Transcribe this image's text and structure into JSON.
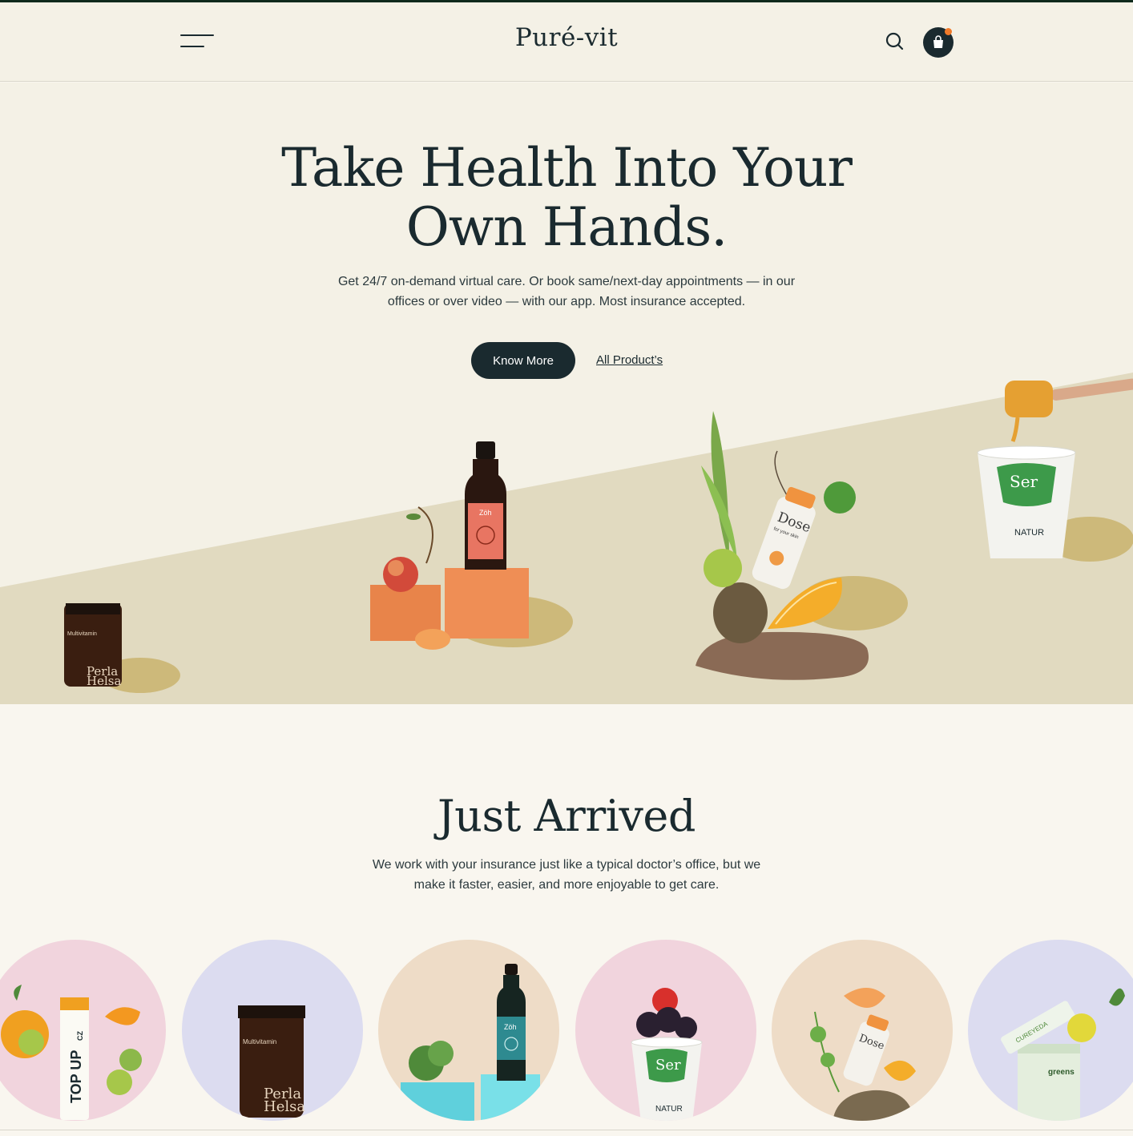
{
  "header": {
    "logo": "Puré-vit",
    "menu_icon": "hamburger-menu-icon",
    "search_icon": "search-icon",
    "cart_icon": "shopping-bag-icon"
  },
  "hero": {
    "title_line1": "Take Health Into Your",
    "title_line2": "Own Hands.",
    "description": "Get 24/7 on-demand virtual care. Or book same/next-day appointments — in our offices or over video — with our app. Most insurance accepted.",
    "primary_button": "Know More",
    "secondary_link": "All Product’s",
    "products": {
      "jar_label_1": "Perla",
      "jar_label_2": "Helsa",
      "jar_small": "Multivitamin",
      "bottle_label": "Zöh",
      "dose_label": "Dose",
      "dose_sub": "for your skin",
      "cup_label": "Ser",
      "cup_sub": "NATUR"
    }
  },
  "arrived": {
    "title": "Just Arrived",
    "description": "We work with your insurance just like a typical doctor’s office, but we make it faster, easier, and more enjoyable to get care.",
    "products": [
      {
        "label": "TOP UP",
        "badge": "CZ",
        "bg": "#f1d4dd"
      },
      {
        "label": "Perla",
        "label2": "Helsa",
        "small": "Multivitamin",
        "bg": "#dcdcf0"
      },
      {
        "label": "Zöh",
        "bg": "#eedcc7"
      },
      {
        "label": "Ser",
        "sub": "NATUR",
        "bg": "#f1d4dd"
      },
      {
        "label": "Dose",
        "bg": "#eedcc7"
      },
      {
        "label": "CUREYEDA",
        "sub": "greens",
        "bg": "#dcdcf0"
      }
    ]
  },
  "colors": {
    "dark": "#1a2a2f",
    "cream": "#f4f1e6",
    "beige": "#e1dac0",
    "accent": "#f07a2a"
  }
}
